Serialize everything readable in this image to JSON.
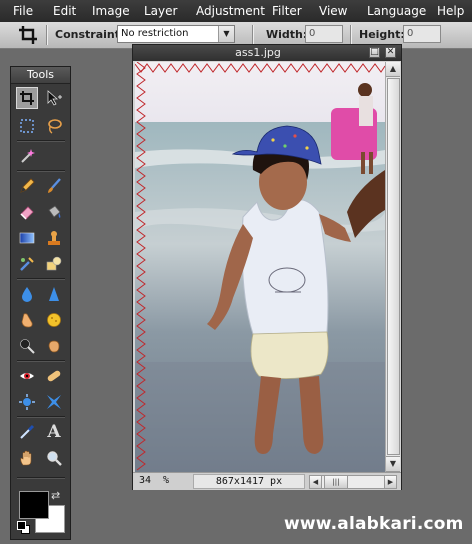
{
  "menu": [
    "File",
    "Edit",
    "Image",
    "Layer",
    "Adjustment",
    "Filter",
    "View",
    "Language",
    "Help"
  ],
  "options": {
    "constraint_label": "Constraint:",
    "constraint_value": "No restriction",
    "width_label": "Width:",
    "width_value": "0",
    "height_label": "Height:",
    "height_value": "0"
  },
  "tools_panel": {
    "title": "Tools",
    "foreground_color": "#000000",
    "background_color": "#ffffff"
  },
  "image_window": {
    "title": "ass1.jpg",
    "zoom": "34",
    "zoom_unit": "%",
    "dimensions": "867x1417 px"
  },
  "watermark": "www.alabkari.com"
}
